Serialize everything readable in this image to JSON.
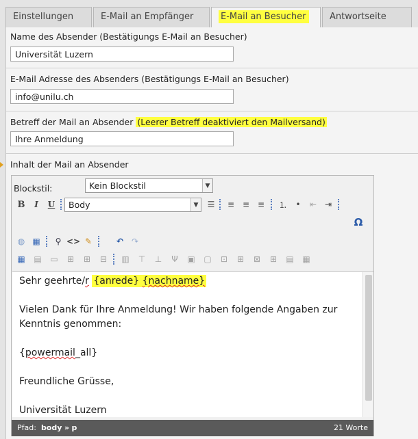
{
  "tabs": [
    {
      "label": "Einstellungen"
    },
    {
      "label": "E-Mail an Empfänger"
    },
    {
      "label": "E-Mail an Besucher"
    },
    {
      "label": "Antwortseite"
    }
  ],
  "form": {
    "sender_name": {
      "label": "Name des Absender (Bestätigungs E-Mail an Besucher)",
      "value": "Universität Luzern"
    },
    "sender_email": {
      "label": "E-Mail Adresse des Absenders (Bestätigungs E-Mail an Besucher)",
      "value": "info@unilu.ch"
    },
    "subject": {
      "label": "Betreff der Mail an Absender",
      "hint": "(Leerer Betreff deaktiviert den Mailversand)",
      "value": "Ihre Anmeldung"
    },
    "body_label": "Inhalt der Mail an Absender"
  },
  "rte": {
    "blockstyle_label": "Blockstil:",
    "blockstyle_value": "Kein Blockstil",
    "format_value": "Body",
    "bold": "B",
    "italic": "I",
    "underline": "U",
    "omega": "Ω",
    "content": {
      "line1_pre": "Sehr geehrte/",
      "line1_r": "r",
      "line1_placeholder1": "{anrede}",
      "line1_placeholder2": "{nachname}",
      "line2": "Vielen Dank für Ihre Anmeldung! Wir haben folgende Angaben zur",
      "line3": "Kenntnis genommen:",
      "line4_open": "{",
      "line4_word": "powermail",
      "line4_close": "_all}",
      "line5": "Freundliche Grüsse,",
      "line6": "Universität Luzern"
    },
    "status": {
      "path_label": "Pfad:",
      "path_body": "body",
      "path_sep": "»",
      "path_p": "p",
      "word_count": "21 Worte"
    }
  },
  "colors": {
    "highlight": "#ffff40",
    "accent": "#5a7fc0"
  }
}
